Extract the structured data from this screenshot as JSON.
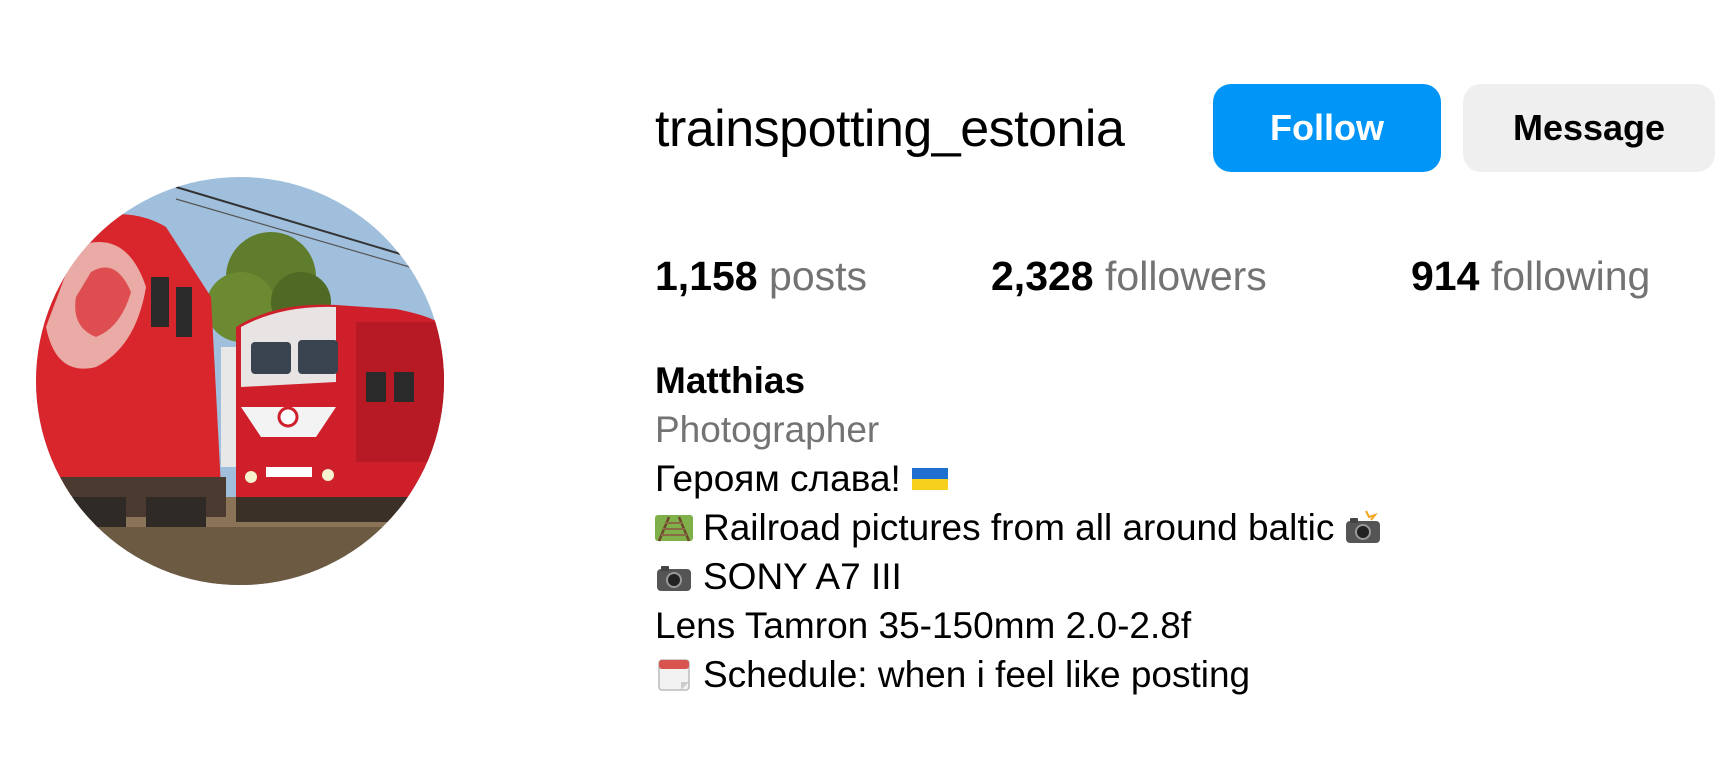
{
  "profile": {
    "username": "trainspotting_estonia",
    "follow_label": "Follow",
    "message_label": "Message",
    "avatar_icon": "avatar-train-photo"
  },
  "stats": {
    "posts_count": "1,158",
    "posts_label": "posts",
    "followers_count": "2,328",
    "followers_label": "followers",
    "following_count": "914",
    "following_label": "following"
  },
  "bio": {
    "name": "Matthias",
    "category": "Photographer",
    "line1": "Героям слава!",
    "line1_icon": "ukraine-flag-icon",
    "line2": "Railroad pictures from all around baltic",
    "line2_icons": [
      "railway-track-icon",
      "camera-flash-icon"
    ],
    "line3": "SONY A7 III",
    "line3_icon": "camera-icon",
    "line4": "Lens Tamron 35-150mm 2.0-2.8f",
    "line5": "Schedule: when i feel like posting",
    "line5_icon": "calendar-icon"
  },
  "colors": {
    "accent": "#0095f6",
    "secondary_button": "#efefef",
    "muted_text": "#737373"
  }
}
